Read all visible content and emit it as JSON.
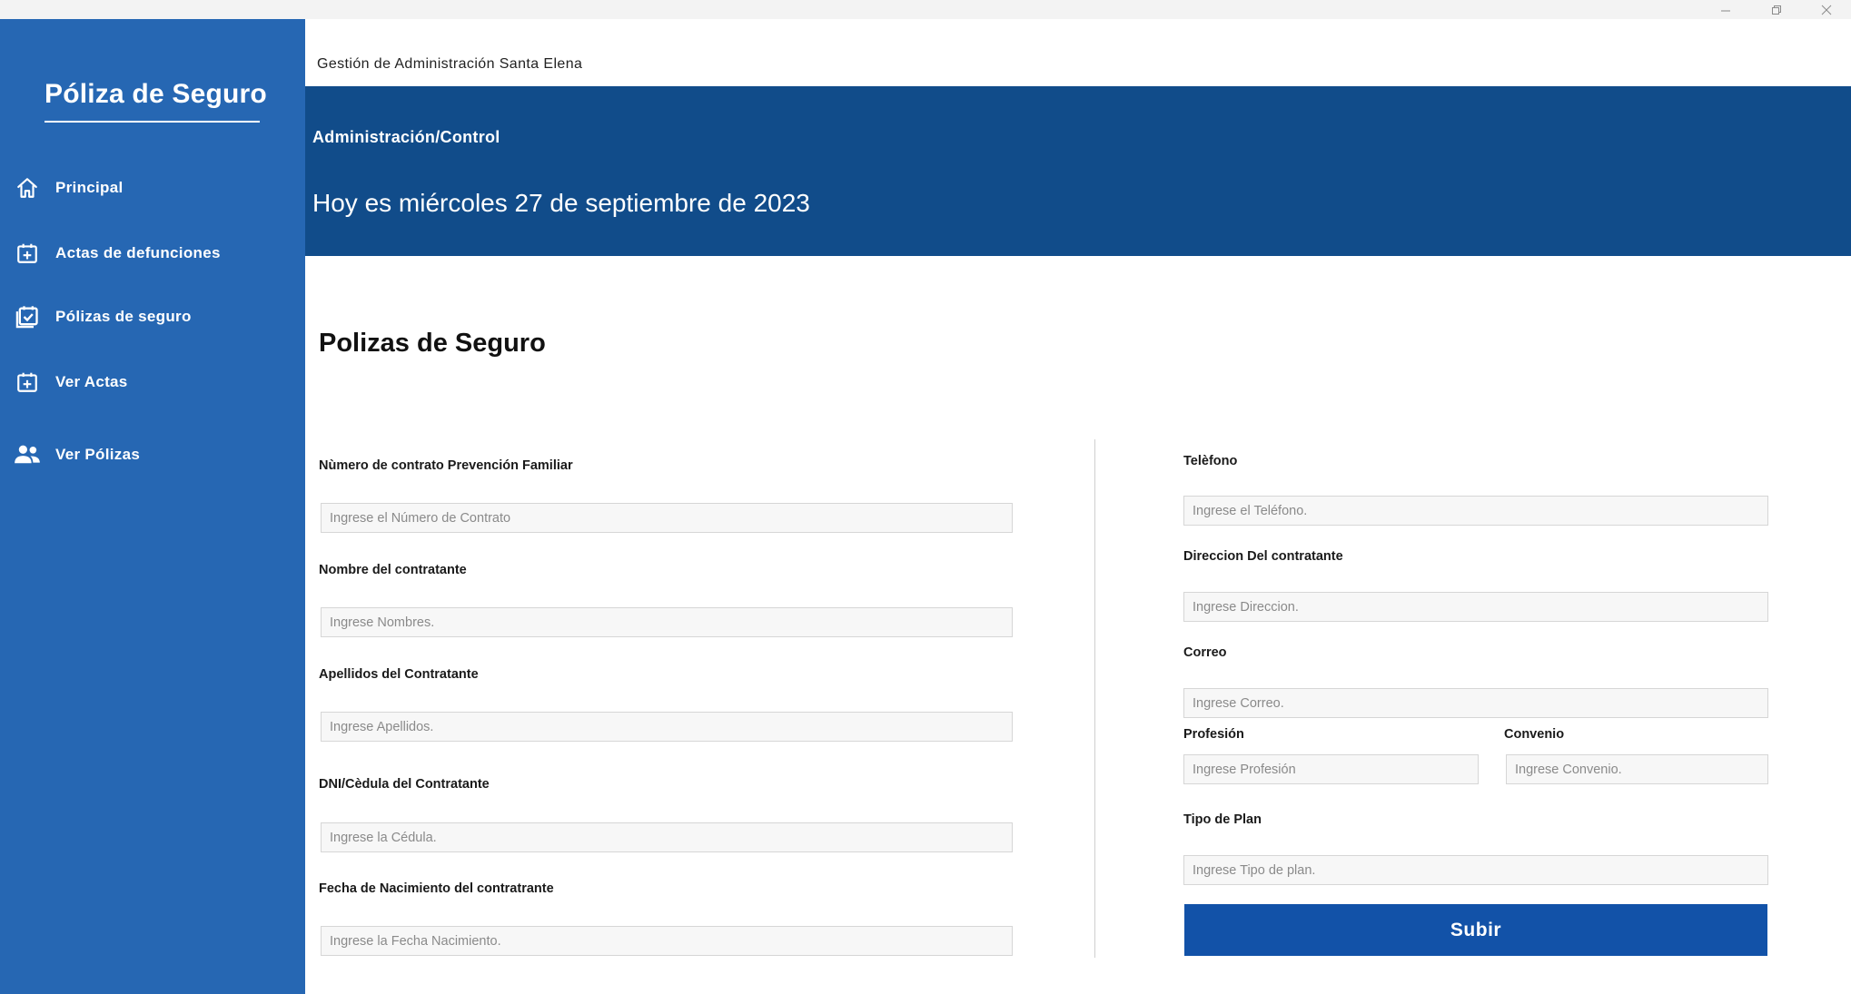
{
  "window": {
    "controls": [
      "minimize",
      "restore",
      "close"
    ]
  },
  "sidebar": {
    "title": "Póliza de Seguro",
    "items": [
      {
        "label": "Principal",
        "icon": "home-icon"
      },
      {
        "label": "Actas de defunciones",
        "icon": "calendar-plus-icon"
      },
      {
        "label": "Pólizas de seguro",
        "icon": "calendar-check-icon"
      },
      {
        "label": "Ver Actas",
        "icon": "calendar-plus-icon"
      },
      {
        "label": "Ver Pólizas",
        "icon": "people-icon"
      }
    ]
  },
  "header": {
    "subtitle": "Gestión de Administración Santa Elena",
    "section": "Administración/Control",
    "date_text": "Hoy es miércoles 27 de septiembre de 2023"
  },
  "main": {
    "title": "Polizas de Seguro",
    "left_fields": [
      {
        "label": "Nùmero de contrato Prevención Familiar",
        "placeholder": "Ingrese el Número de Contrato"
      },
      {
        "label": "Nombre del contratante",
        "placeholder": "Ingrese Nombres."
      },
      {
        "label": "Apellidos del Contratante",
        "placeholder": "Ingrese Apellidos."
      },
      {
        "label": "DNI/Cèdula del Contratante",
        "placeholder": "Ingrese la Cédula."
      },
      {
        "label": "Fecha de Nacimiento del contratrante",
        "placeholder": "Ingrese la Fecha Nacimiento."
      }
    ],
    "right_fields": {
      "telefono": {
        "label": "Telèfono",
        "placeholder": "Ingrese el Teléfono."
      },
      "direccion": {
        "label": "Direccion Del contratante",
        "placeholder": "Ingrese Direccion."
      },
      "correo": {
        "label": "Correo",
        "placeholder": "Ingrese Correo."
      },
      "profesion": {
        "label": "Profesión",
        "placeholder": "Ingrese Profesión"
      },
      "convenio": {
        "label": "Convenio",
        "placeholder": "Ingrese Convenio."
      },
      "tipo_plan": {
        "label": "Tipo de Plan",
        "placeholder": "Ingrese Tipo de plan."
      }
    },
    "submit_label": "Subir"
  },
  "colors": {
    "sidebar": "#2667b3",
    "banner": "#114c8a",
    "button": "#1252a8"
  }
}
